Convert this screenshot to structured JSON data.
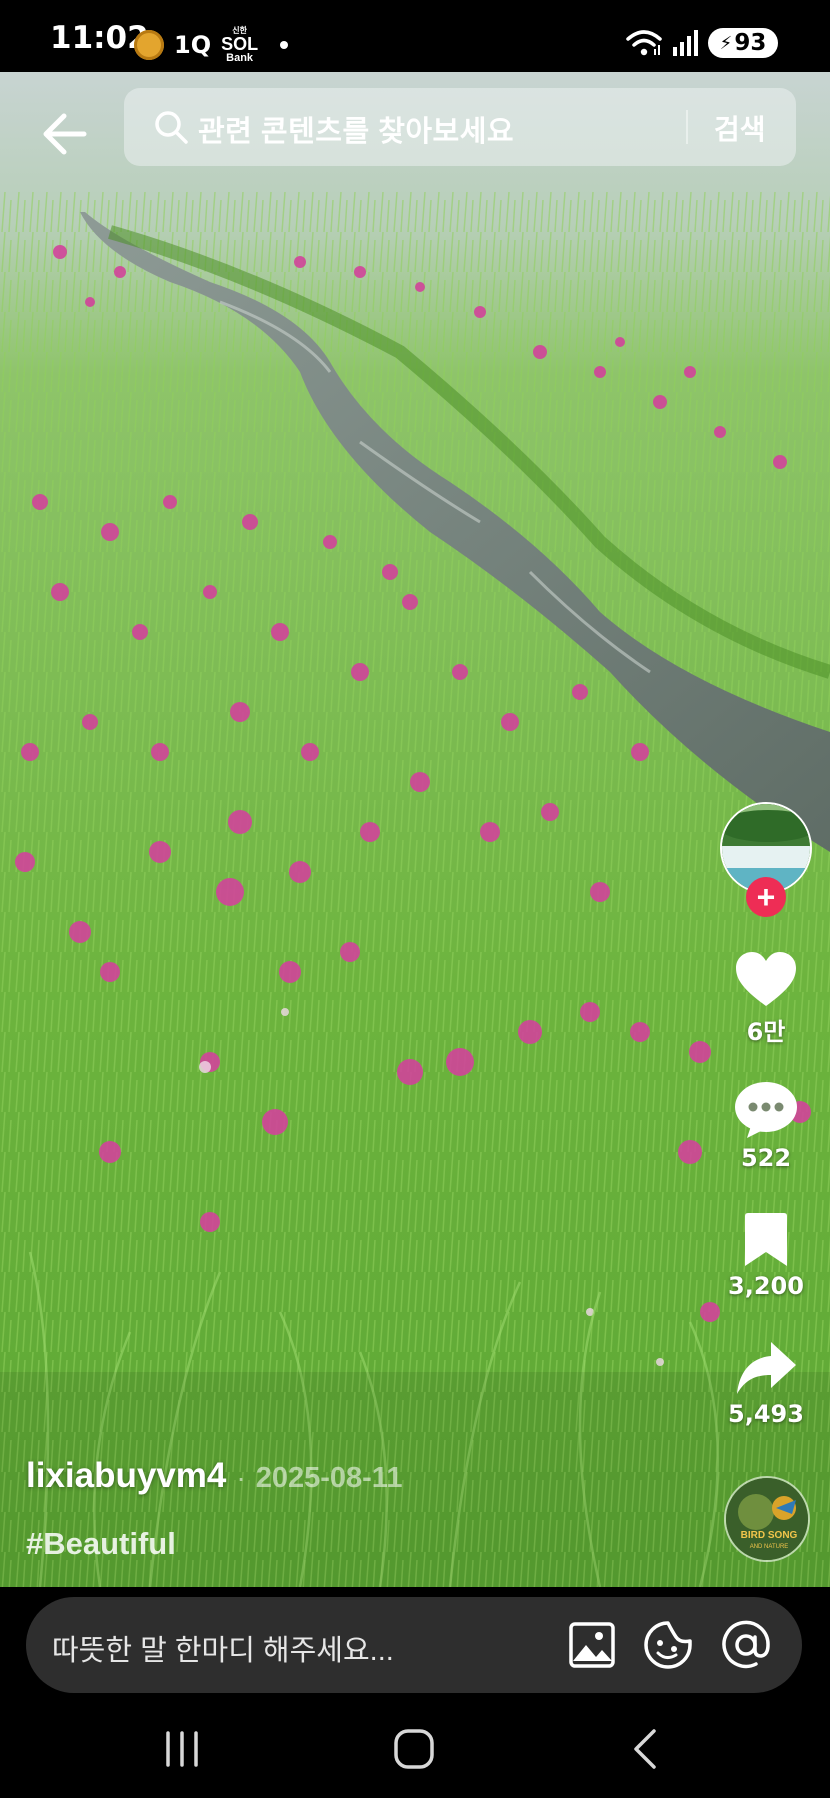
{
  "status_bar": {
    "time": "11:02",
    "app_icon_text": "1Q",
    "bank_label_small": "신한",
    "bank_label_big": "SOL",
    "bank_label_sub": "Bank",
    "battery": "93"
  },
  "search": {
    "placeholder": "관련 콘텐츠를 찾아보세요",
    "button_label": "검색"
  },
  "actions": {
    "likes": "6만",
    "comments": "522",
    "saves": "3,200",
    "shares": "5,493",
    "follow_symbol": "+"
  },
  "post": {
    "author": "lixiabuyvm4",
    "separator": "·",
    "date": "2025-08-11",
    "hashtag": "#Beautiful"
  },
  "sound_disc": {
    "text_line1": "BIRD SONG",
    "text_line2": "AND NATURE"
  },
  "comment_bar": {
    "placeholder": "따뜻한 말 한마디 해주세요..."
  },
  "colors": {
    "follow_red": "#ee2d55",
    "grass_green": "#6fb43f",
    "flower_pink": "#d1449a"
  }
}
